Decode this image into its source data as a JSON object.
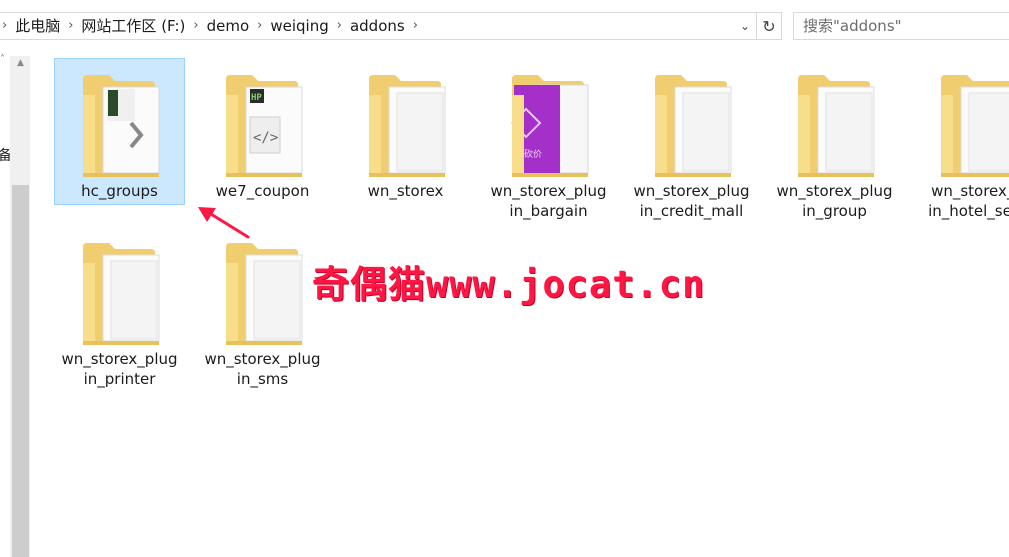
{
  "address_bar": {
    "breadcrumbs": [
      "此电脑",
      "网站工作区 (F:)",
      "demo",
      "weiqing",
      "addons"
    ]
  },
  "search": {
    "placeholder": "搜索\"addons\""
  },
  "nav_pane": {
    "truncated_label": "备"
  },
  "files": [
    {
      "name": "hc_groups",
      "label": "hc_groups",
      "selected": true,
      "overlay": "file-page"
    },
    {
      "name": "we7_coupon",
      "label": "we7_coupon",
      "selected": false,
      "overlay": "php-code"
    },
    {
      "name": "wn_storex",
      "label": "wn_storex",
      "selected": false,
      "overlay": "blank"
    },
    {
      "name": "wn_storex_plugin_bargain",
      "label": "wn_storex_plug\nin_bargain",
      "selected": false,
      "overlay": "purple-card"
    },
    {
      "name": "wn_storex_plugin_credit_mall",
      "label": "wn_storex_plug\nin_credit_mall",
      "selected": false,
      "overlay": "blank"
    },
    {
      "name": "wn_storex_plugin_group",
      "label": "wn_storex_plug\nin_group",
      "selected": false,
      "overlay": "blank"
    },
    {
      "name": "wn_storex_plugin_hotel_service",
      "label": "wn_storex_p\nin_hotel_serv",
      "selected": false,
      "overlay": "blank"
    },
    {
      "name": "wn_storex_plugin_printer",
      "label": "wn_storex_plug\nin_printer",
      "selected": false,
      "overlay": "blank"
    },
    {
      "name": "wn_storex_plugin_sms",
      "label": "wn_storex_plug\nin_sms",
      "selected": false,
      "overlay": "blank"
    }
  ],
  "watermark": {
    "text": "奇偶猫www.jocat.cn"
  },
  "colors": {
    "selection": "#cce8ff",
    "selection_border": "#99d1ff",
    "folder_back": "#f0cd6e",
    "folder_front": "#f8dd8a",
    "annotation_red": "#ff1744",
    "purple_card": "#a52fc9"
  },
  "icons": {
    "folder": "folder-icon",
    "breadcrumb_separator": "chevron-right-icon",
    "dropdown": "chevron-down-icon",
    "refresh": "refresh-icon"
  }
}
